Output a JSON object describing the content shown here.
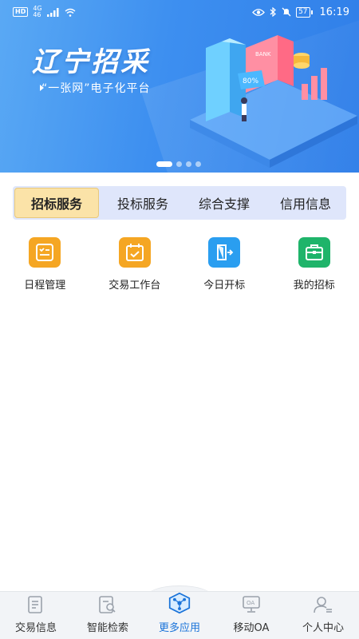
{
  "status_bar": {
    "badge": "HD",
    "network_top": "4G",
    "network_bottom": "46",
    "battery": "57",
    "time": "16:19"
  },
  "banner": {
    "title": "辽宁招采",
    "subtitle": "“一张网”电子化平台",
    "art_percent": "80%",
    "art_bank": "BANK",
    "pagination_total": 4,
    "pagination_active": 1
  },
  "tabs": [
    {
      "label": "招标服务",
      "active": true
    },
    {
      "label": "投标服务",
      "active": false
    },
    {
      "label": "综合支撑",
      "active": false
    },
    {
      "label": "信用信息",
      "active": false
    }
  ],
  "apps": [
    {
      "label": "日程管理",
      "icon": "schedule-checklist-icon",
      "color": "#f5a623"
    },
    {
      "label": "交易工作台",
      "icon": "calendar-check-icon",
      "color": "#f5a623"
    },
    {
      "label": "今日开标",
      "icon": "door-open-icon",
      "color": "#2a9ef0"
    },
    {
      "label": "我的招标",
      "icon": "toolbox-icon",
      "color": "#1fb46a"
    }
  ],
  "bottom_nav": [
    {
      "label": "交易信息",
      "icon": "document-list-icon",
      "active": false
    },
    {
      "label": "智能检索",
      "icon": "search-document-icon",
      "active": false
    },
    {
      "label": "更多应用",
      "icon": "cube-network-icon",
      "active": true
    },
    {
      "label": "移动OA",
      "icon": "oa-monitor-icon",
      "active": false
    },
    {
      "label": "个人中心",
      "icon": "user-profile-icon",
      "active": false
    }
  ],
  "colors": {
    "banner_blue": "#3d8ff0",
    "tab_active_bg": "#fbe3a8",
    "tabs_bg": "#dfe6fb",
    "nav_active": "#1a73d9"
  }
}
